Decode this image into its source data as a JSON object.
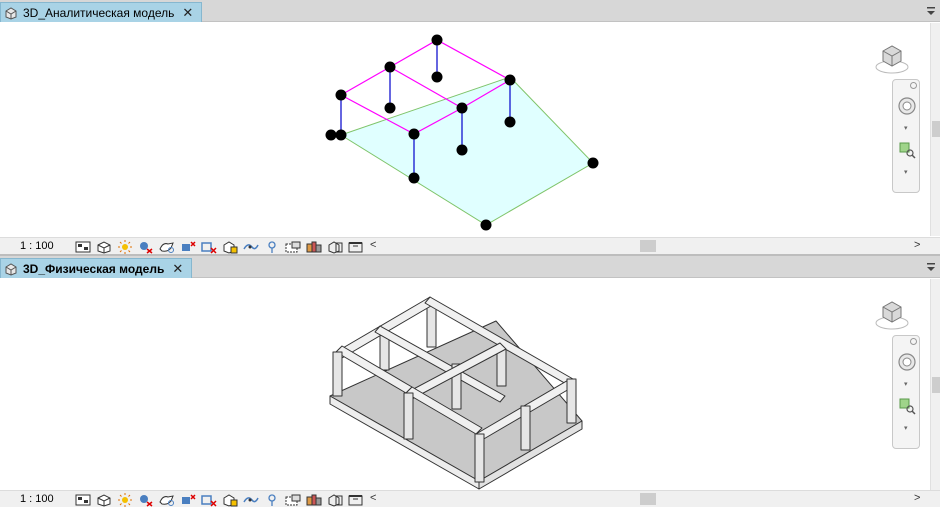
{
  "views": [
    {
      "title": "3D_Аналитическая модель",
      "scale": "1 : 100"
    },
    {
      "title": "3D_Физическая модель",
      "scale": "1 : 100"
    }
  ],
  "icons": {
    "tab": "3d-view-icon",
    "close": "close-icon",
    "view_cube": "view-cube-icon",
    "steering_wheel": "steering-wheel-icon",
    "zoom": "zoom-region-icon"
  },
  "glyphs": {
    "close": "✕",
    "left": "<",
    "right": ">",
    "down": "▾"
  },
  "colors": {
    "tab_bg": "#a9d3e6",
    "beam": "#ff00ff",
    "column": "#0000cc",
    "slab_fill": "#e0ffff",
    "slab_edge": "#7fc46a",
    "node": "#000000"
  }
}
